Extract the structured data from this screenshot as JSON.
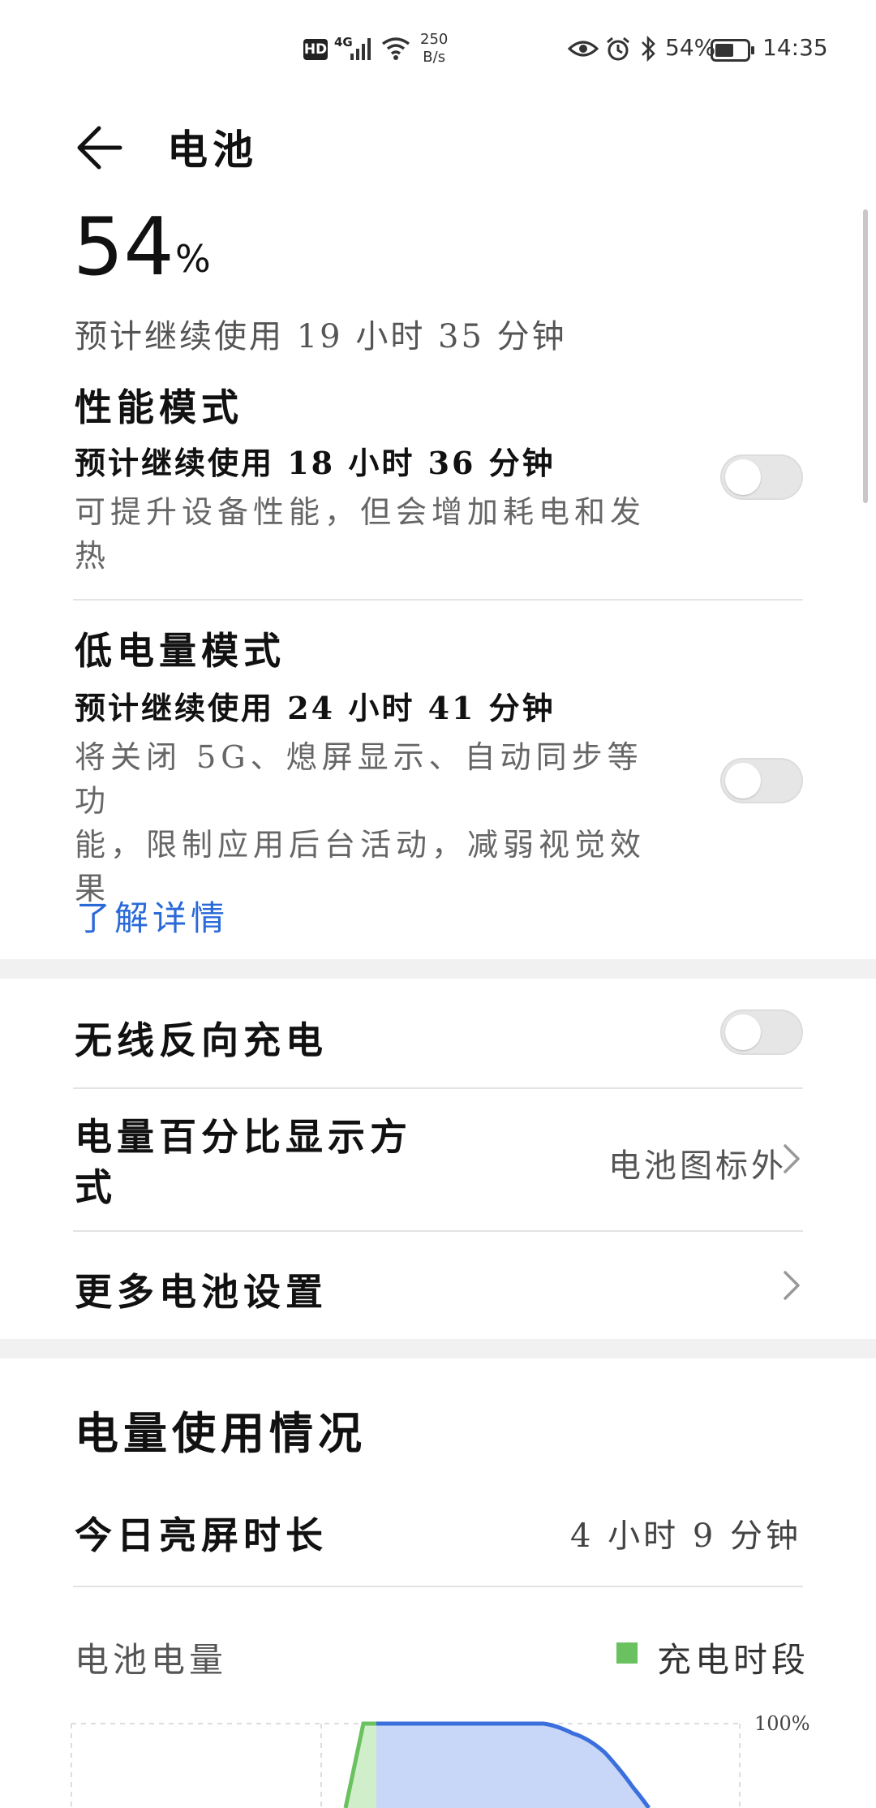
{
  "status_bar": {
    "hd": "HD",
    "network": "4G",
    "speed_value": "250",
    "speed_unit": "B/s",
    "battery_percent": "54%",
    "time": "14:35"
  },
  "header": {
    "title": "电池"
  },
  "battery": {
    "percent_value": "54",
    "percent_sign": "%",
    "estimate": "预计继续使用 19 小时 35 分钟"
  },
  "performance_mode": {
    "title": "性能模式",
    "estimate": "预计继续使用 18 小时 36 分钟",
    "desc_line1": "可提升设备性能，但会增加耗电和发",
    "desc_line2": "热",
    "enabled": false
  },
  "low_power_mode": {
    "title": "低电量模式",
    "estimate": "预计继续使用 24 小时 41 分钟",
    "desc_line1": "将关闭 5G、熄屏显示、自动同步等功",
    "desc_line2": "能，限制应用后台活动，减弱视觉效",
    "desc_line3": "果",
    "enabled": false,
    "learn_more": "了解详情"
  },
  "settings": {
    "wireless_reverse": {
      "label": "无线反向充电",
      "enabled": false
    },
    "percent_display": {
      "label_line1": "电量百分比显示方",
      "label_line2": "式",
      "value": "电池图标外"
    },
    "more_settings": {
      "label": "更多电池设置"
    }
  },
  "usage": {
    "title": "电量使用情况",
    "screen_time_label": "今日亮屏时长",
    "screen_time_value": "4 小时 9 分钟",
    "battery_level_label": "电池电量",
    "legend_charging": "充电时段",
    "tick_top": "100%"
  },
  "colors": {
    "accent": "#2a6ad8",
    "charging_green": "#69c25f",
    "chart_line": "#3a6fdc",
    "chart_fill": "#c8d6f7"
  }
}
